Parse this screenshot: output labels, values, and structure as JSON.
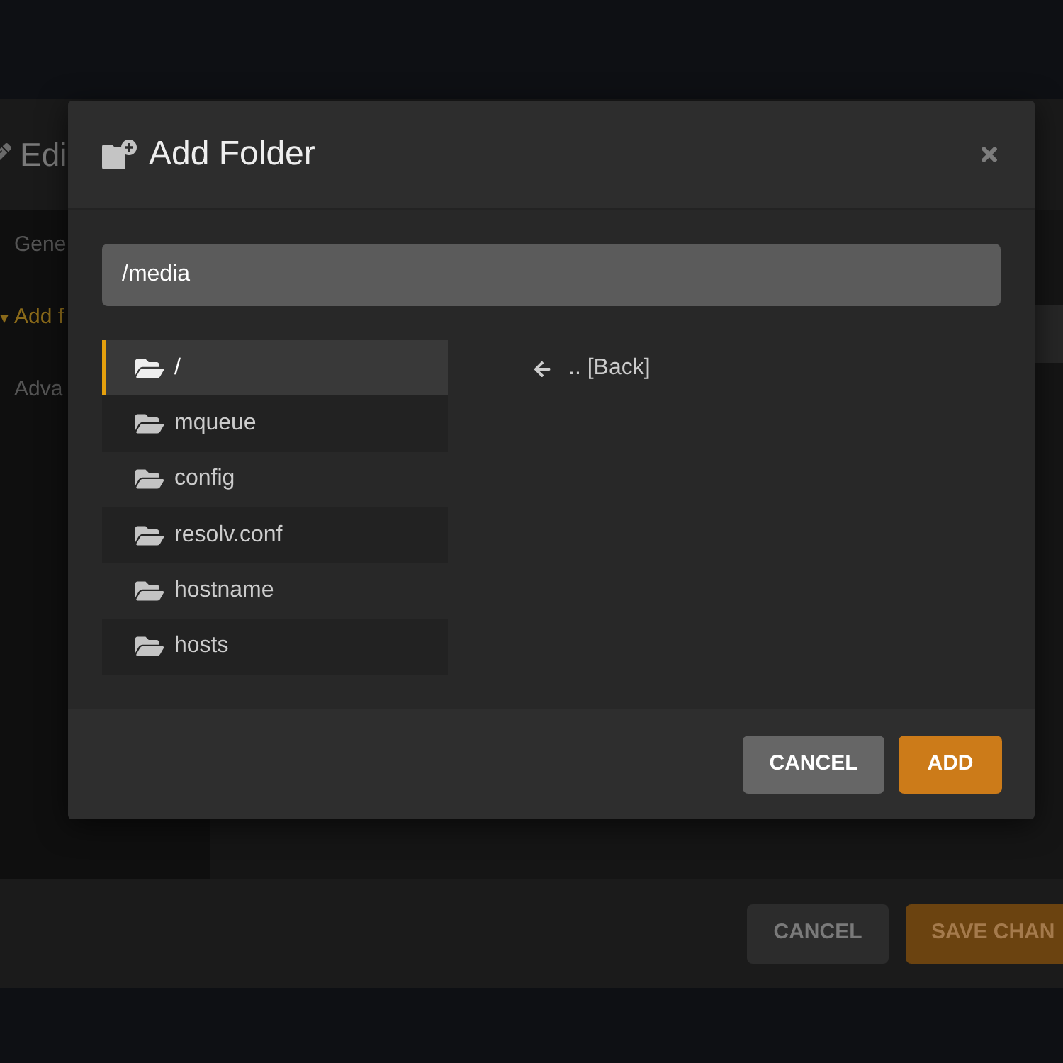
{
  "background_dialog": {
    "title": "Edi",
    "sidebar": {
      "items": [
        {
          "label": "Gene",
          "selected": false
        },
        {
          "label": "Add f",
          "selected": true
        },
        {
          "label": "Adva",
          "selected": false
        }
      ]
    },
    "footer": {
      "buttons": [
        {
          "label": "CANCEL",
          "kind": "secondary"
        },
        {
          "label": "SAVE CHAN",
          "kind": "primary"
        }
      ]
    }
  },
  "modal": {
    "title": "Add Folder",
    "path_field": {
      "value": "/media"
    },
    "folders": [
      {
        "name": "/",
        "selected": true
      },
      {
        "name": "mqueue",
        "selected": false
      },
      {
        "name": "config",
        "selected": false
      },
      {
        "name": "resolv.conf",
        "selected": false
      },
      {
        "name": "hostname",
        "selected": false
      },
      {
        "name": "hosts",
        "selected": false
      }
    ],
    "back_link": {
      "label": ".. [Back]"
    },
    "buttons": [
      {
        "label": "CANCEL",
        "kind": "secondary"
      },
      {
        "label": "ADD",
        "kind": "primary"
      }
    ]
  }
}
